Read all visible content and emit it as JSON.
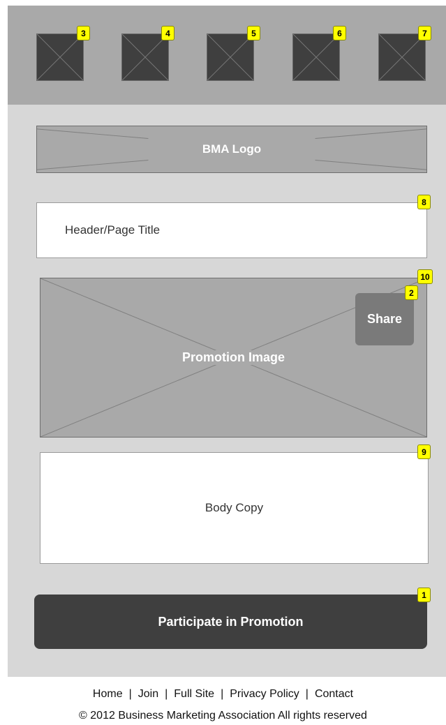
{
  "badges": {
    "b1": "1",
    "b2": "2",
    "b3": "3",
    "b4": "4",
    "b5": "5",
    "b6": "6",
    "b7": "7",
    "b8": "8",
    "b9": "9",
    "b10": "10"
  },
  "logo_label": "BMA Logo",
  "header_title": "Header/Page Title",
  "promo_label": "Promotion Image",
  "share_label": "Share",
  "body_copy": "Body Copy",
  "cta_label": "Participate in Promotion",
  "footer": {
    "links": [
      "Home",
      "Join",
      "Full Site",
      "Privacy Policy",
      "Contact"
    ],
    "separator": "|",
    "copyright": "© 2012 Business Marketing Association All rights reserved"
  },
  "colors": {
    "topbar": "#a9a9a9",
    "panel": "#d7d7d7",
    "placeholder": "#a9a9a9",
    "icon": "#3f3f3f",
    "badge": "#ffff00",
    "cta": "#3f3f3f"
  }
}
